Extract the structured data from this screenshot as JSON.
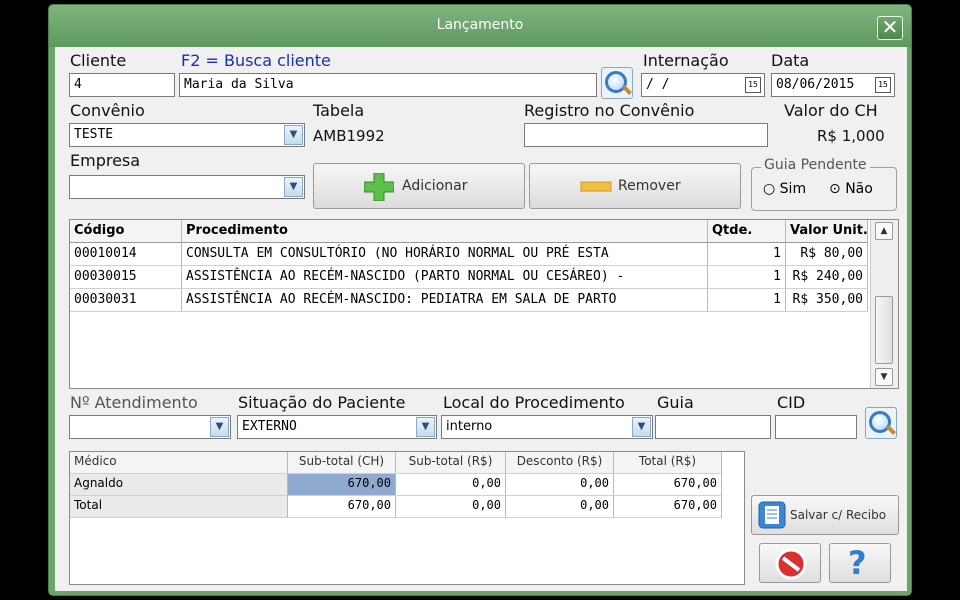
{
  "window": {
    "title": "Lançamento",
    "close_label": "✕"
  },
  "form": {
    "cliente_label": "Cliente",
    "busca_hint": "F2 = Busca cliente",
    "cliente_id": "4",
    "cliente_nome": "Maria da Silva",
    "internacao_label": "Internação",
    "internacao_value": " / /",
    "data_label": "Data",
    "data_value": "08/06/2015",
    "convenio_label": "Convênio",
    "convenio_value": "TESTE",
    "tabela_label": "Tabela",
    "tabela_value": "AMB1992",
    "registro_label": "Registro no Convênio",
    "registro_value": "",
    "valor_ch_label": "Valor do CH",
    "valor_ch_value": "R$ 1,000",
    "empresa_label": "Empresa",
    "empresa_value": "",
    "adicionar_label": "Adicionar",
    "remover_label": "Remover",
    "guia_pendente_label": "Guia Pendente",
    "guia_sim": "Sim",
    "guia_nao": "Não"
  },
  "procedures": {
    "headers": [
      "Código",
      "Procedimento",
      "Qtde.",
      "Valor Unit."
    ],
    "rows": [
      {
        "codigo": "00010014",
        "procedimento": "CONSULTA EM CONSULTÓRIO (NO HORÁRIO NORMAL OU PRÉ ESTA",
        "qtde": "1",
        "valor": "R$ 80,00"
      },
      {
        "codigo": "00030015",
        "procedimento": "ASSISTÊNCIA AO RECÉM-NASCIDO (PARTO NORMAL OU CESÁREO) -",
        "qtde": "1",
        "valor": "R$ 240,00"
      },
      {
        "codigo": "00030031",
        "procedimento": "ASSISTÊNCIA AO RECÉM-NASCIDO: PEDIATRA EM SALA DE PARTO",
        "qtde": "1",
        "valor": "R$ 350,00"
      }
    ]
  },
  "lower": {
    "atendimento_label": "Nº Atendimento",
    "atendimento_value": "",
    "situacao_label": "Situação do Paciente",
    "situacao_value": "EXTERNO",
    "local_label": "Local do Procedimento",
    "local_value": "interno",
    "guia_label": "Guia",
    "guia_value": "",
    "cid_label": "CID",
    "cid_value": ""
  },
  "summary": {
    "headers": [
      "Médico",
      "Sub-total (CH)",
      "Sub-total (R$)",
      "Desconto (R$)",
      "Total (R$)"
    ],
    "rows": [
      {
        "medico": "Agnaldo",
        "ch": "670,00",
        "rs": "0,00",
        "desc": "0,00",
        "total": "670,00"
      },
      {
        "medico": "Total",
        "ch": "670,00",
        "rs": "0,00",
        "desc": "0,00",
        "total": "670,00"
      }
    ]
  },
  "actions": {
    "salvar_label": "Salvar c/ Recibo",
    "help_label": "?"
  }
}
